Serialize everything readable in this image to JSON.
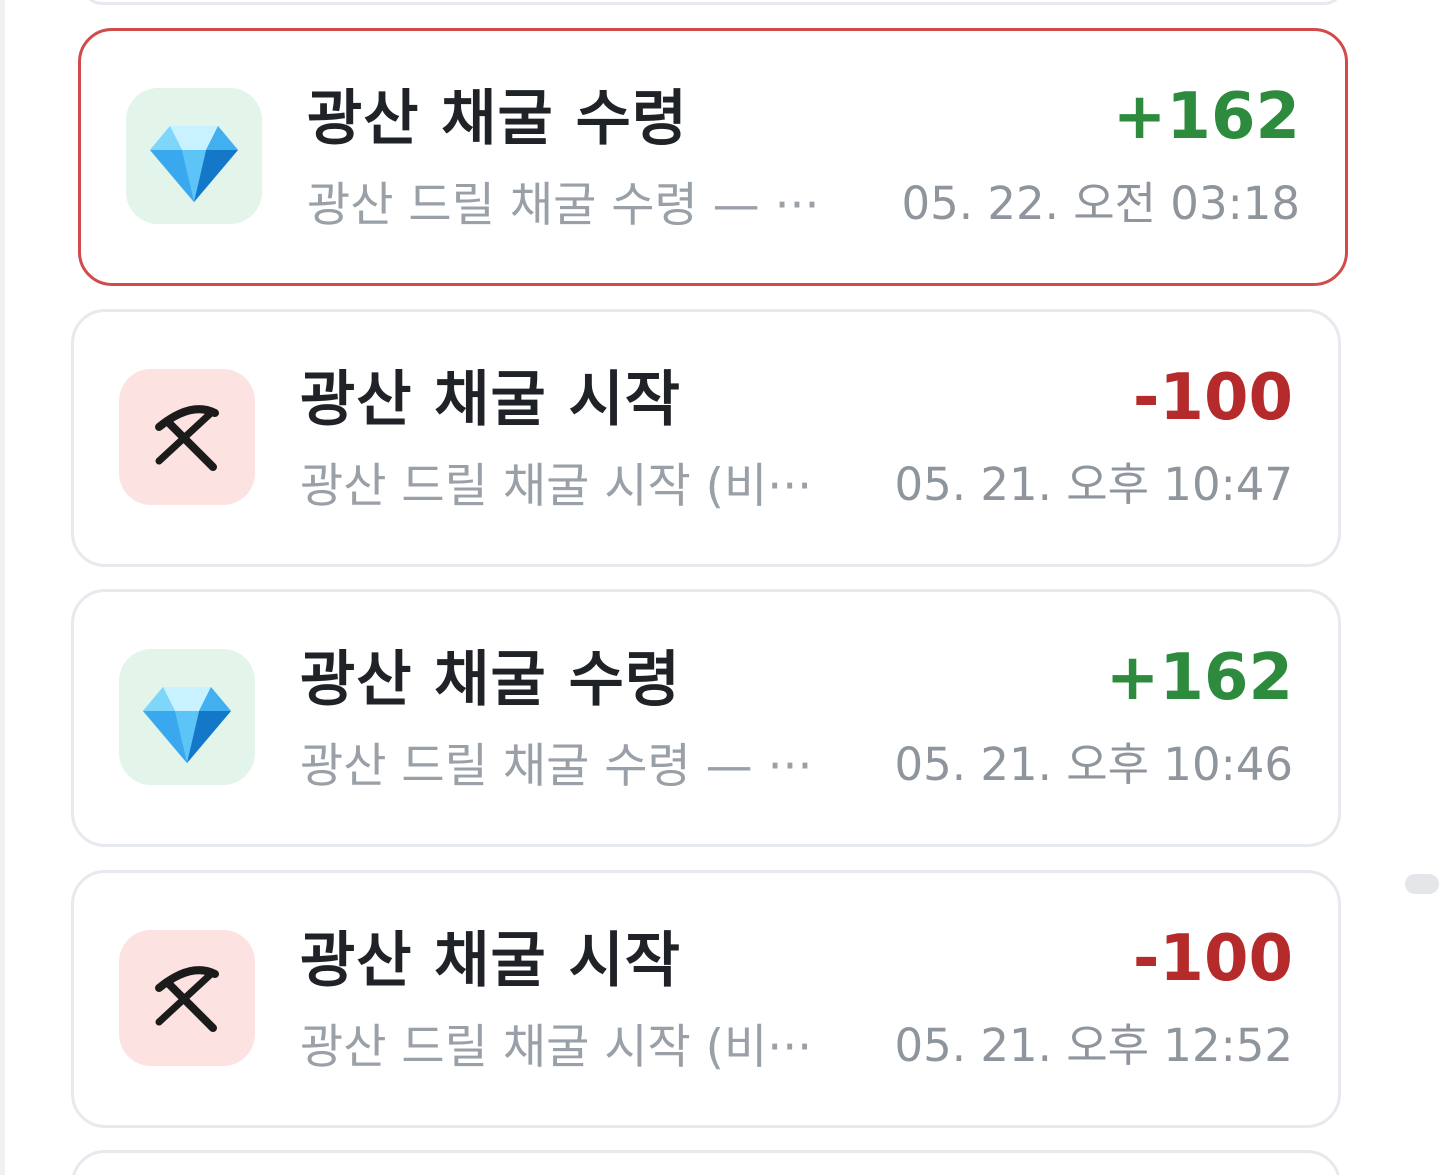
{
  "transactions": [
    {
      "title": "광산 채굴 수령",
      "description": "광산 드릴 채굴 수령 — ···",
      "amount": "+162",
      "time": "05. 22. 오전 03:18",
      "icon": "diamond-icon",
      "type": "credit"
    },
    {
      "title": "광산 채굴 시작",
      "description": "광산 드릴 채굴 시작 (비···",
      "amount": "-100",
      "time": "05. 21. 오후 10:47",
      "icon": "pickaxe-icon",
      "type": "debit"
    },
    {
      "title": "광산 채굴 수령",
      "description": "광산 드릴 채굴 수령 — ···",
      "amount": "+162",
      "time": "05. 21. 오후 10:46",
      "icon": "diamond-icon",
      "type": "credit"
    },
    {
      "title": "광산 채굴 시작",
      "description": "광산 드릴 채굴 시작 (비···",
      "amount": "-100",
      "time": "05. 21. 오후 12:52",
      "icon": "pickaxe-icon",
      "type": "debit"
    }
  ],
  "colors": {
    "credit": "#2e8b3e",
    "debit": "#b52a2a",
    "highlight_border": "#d24b4b",
    "card_border": "#e6e9ee",
    "credit_icon_bg": "#e3f4ea",
    "debit_icon_bg": "#fde2e2"
  }
}
